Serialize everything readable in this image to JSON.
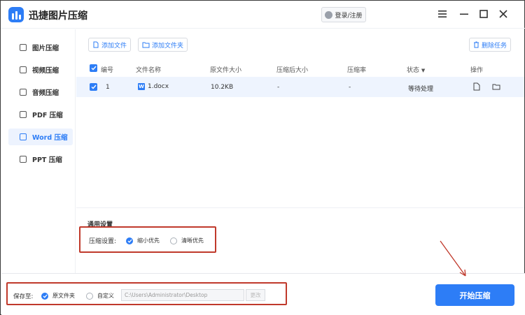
{
  "app": {
    "title": "迅捷图片压缩"
  },
  "header": {
    "login_label": "登录/注册"
  },
  "sidebar": {
    "items": [
      {
        "label": "图片压缩",
        "icon": "image-icon"
      },
      {
        "label": "视频压缩",
        "icon": "video-icon"
      },
      {
        "label": "音频压缩",
        "icon": "audio-icon"
      },
      {
        "label": "PDF 压缩",
        "icon": "pdf-icon"
      },
      {
        "label": "Word 压缩",
        "icon": "word-icon",
        "active": true
      },
      {
        "label": "PPT 压缩",
        "icon": "ppt-icon"
      }
    ]
  },
  "toolbar": {
    "add_file": "添加文件",
    "add_folder": "添加文件夹",
    "delete_task": "删除任务"
  },
  "table": {
    "headers": {
      "index": "编号",
      "name": "文件名称",
      "original_size": "原文件大小",
      "compressed_size": "压缩后大小",
      "ratio": "压缩率",
      "status": "状态",
      "actions": "操作"
    },
    "rows": [
      {
        "index": "1",
        "name": "1.docx",
        "original_size": "10.2KB",
        "compressed_size": "-",
        "ratio": "-",
        "status": "等待处理"
      }
    ]
  },
  "settings": {
    "section_title": "通用设置",
    "compress_label": "压缩设置:",
    "option_small": "缩小优先",
    "option_clear": "清晰优先",
    "selected": "缩小优先"
  },
  "footer": {
    "save_to_label": "保存至:",
    "option_original": "原文件夹",
    "option_custom": "自定义",
    "path_value": "C:\\Users\\Administrator\\Desktop",
    "change_label": "更改",
    "start_label": "开始压缩"
  },
  "colors": {
    "accent": "#2d7df6",
    "highlight_box": "#c0392b"
  }
}
